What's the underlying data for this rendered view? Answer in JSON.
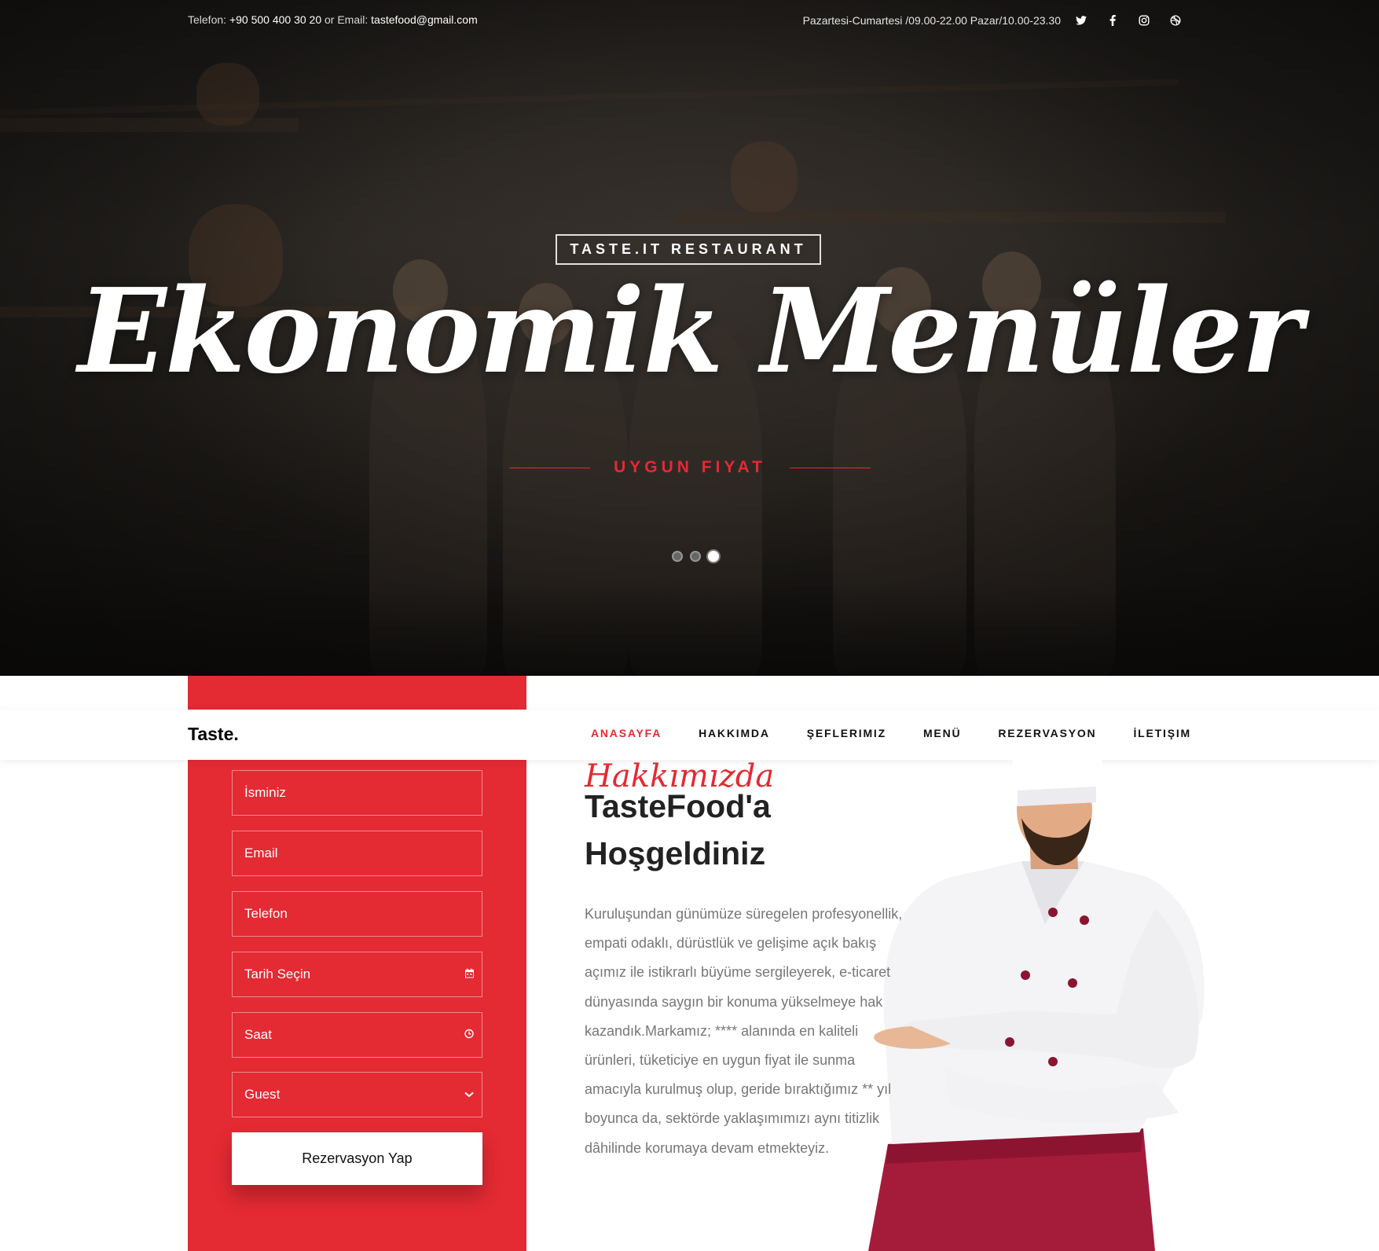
{
  "topbar": {
    "phone_label": "Telefon:",
    "phone": "+90 500 400 30 20",
    "or": "or",
    "email_label": "Email:",
    "email": "tastefood@gmail.com",
    "hours": "Pazartesi-Cumartesi /09.00-22.00 Pazar/10.00-23.30",
    "social_icons": [
      "twitter-icon",
      "facebook-icon",
      "instagram-icon",
      "dribbble-icon"
    ]
  },
  "hero": {
    "badge": "TASTE.IT RESTAURANT",
    "title": "Ekonomik Menüler",
    "subtitle": "UYGUN FIYAT",
    "slides": 3,
    "active_slide": 3
  },
  "navbar": {
    "brand": "Taste.",
    "items": [
      "ANASAYFA",
      "HAKKIMDA",
      "ŞEFLERIMIZ",
      "MENÜ",
      "REZERVASYON",
      "İLETIŞIM"
    ],
    "active": "ANASAYFA"
  },
  "form": {
    "name_placeholder": "İsminiz",
    "email_placeholder": "Email",
    "phone_placeholder": "Telefon",
    "date_placeholder": "Tarih Seçin",
    "time_placeholder": "Saat",
    "guest_selected": "Guest",
    "submit": "Rezervasyon Yap"
  },
  "about": {
    "script": "Hakkımızda",
    "title_line1": "TasteFood'a",
    "title_line2": "Hoşgeldiniz",
    "text": "Kuruluşundan günümüze süregelen profesyonellik, empati odaklı, dürüstlük ve gelişime açık bakış açımız ile istikrarlı büyüme sergileyerek, e-ticaret dünyasında saygın bir konuma yükselmeye hak kazandık.Markamız; **** alanında en kaliteli ürünleri, tüketiciye en uygun fiyat ile sunma amacıyla kurulmuş olup, geride bıraktığımız ** yıl boyunca da, sektörde yaklaşımımızı aynı titizlik dâhilinde korumaya devam etmekteyiz."
  },
  "colors": {
    "accent": "#e42a33",
    "nav_text": "#111111",
    "body_text": "#777777"
  }
}
